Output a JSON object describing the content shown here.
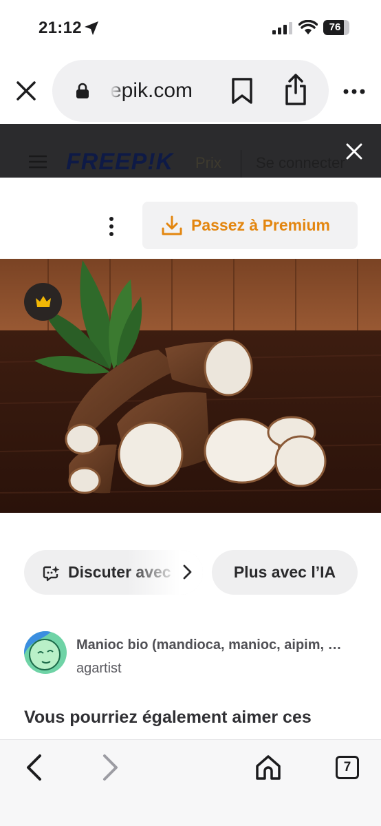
{
  "status_bar": {
    "time": "21:12",
    "battery_level": "76",
    "battery_fraction": 0.76,
    "icons": [
      "location-arrow-icon",
      "signal-icon",
      "wifi-icon",
      "battery-icon"
    ]
  },
  "browser": {
    "url": "epik.com",
    "icons": [
      "close-icon",
      "lock-icon",
      "bookmark-icon",
      "share-icon",
      "more-icon"
    ]
  },
  "banner": {
    "logo": "FREEP!K",
    "pricing_link": "Prix",
    "login_link": "Se connecter",
    "icons": [
      "menu-icon",
      "close-icon"
    ]
  },
  "premium": {
    "label": "Passez à Premium",
    "accent_color": "#e3860f",
    "icons": [
      "kebab-menu-icon",
      "download-icon"
    ]
  },
  "hero_image": {
    "badge_icon": "crown-icon",
    "badge_color": "#f2b705"
  },
  "actions": {
    "discuss_label": "Discuter avec",
    "ai_label": "Plus avec l’IA",
    "icons": [
      "chat-ai-icon",
      "chevron-right-icon"
    ]
  },
  "asset": {
    "title": "Manioc bio (mandioca, manioc, aipim, …",
    "author": "agartist"
  },
  "related": {
    "heading": "Vous pourriez également aimer ces"
  },
  "toolbar": {
    "tab_count": "7",
    "icons": [
      "back-icon",
      "forward-icon",
      "home-icon",
      "tabs-icon"
    ]
  }
}
